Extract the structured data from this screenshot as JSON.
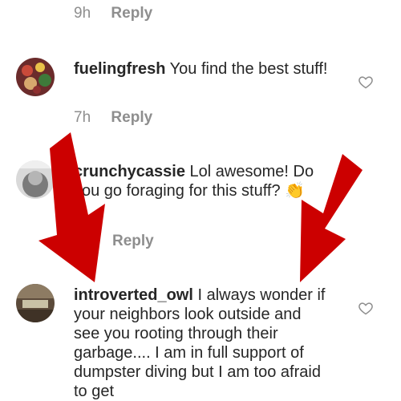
{
  "comments": [
    {
      "time": "9h",
      "reply": "Reply"
    },
    {
      "username": "fuelingfresh",
      "text": "You find the best stuff!",
      "time": "7h",
      "reply": "Reply"
    },
    {
      "username": "crunchycassie",
      "text": "Lol awesome! Do you go foraging for this stuff?",
      "emoji": "👏",
      "reply": "Reply"
    },
    {
      "username": "introverted_owl",
      "text": "I always wonder if your neighbors look outside and see you rooting through their garbage.... I am in full support of dumpster diving but I am too afraid to get"
    }
  ],
  "icons": {
    "like": "heart-outline-icon"
  },
  "colors": {
    "arrow": "#cc0000",
    "meta": "#8e8e8e",
    "text": "#262626"
  }
}
